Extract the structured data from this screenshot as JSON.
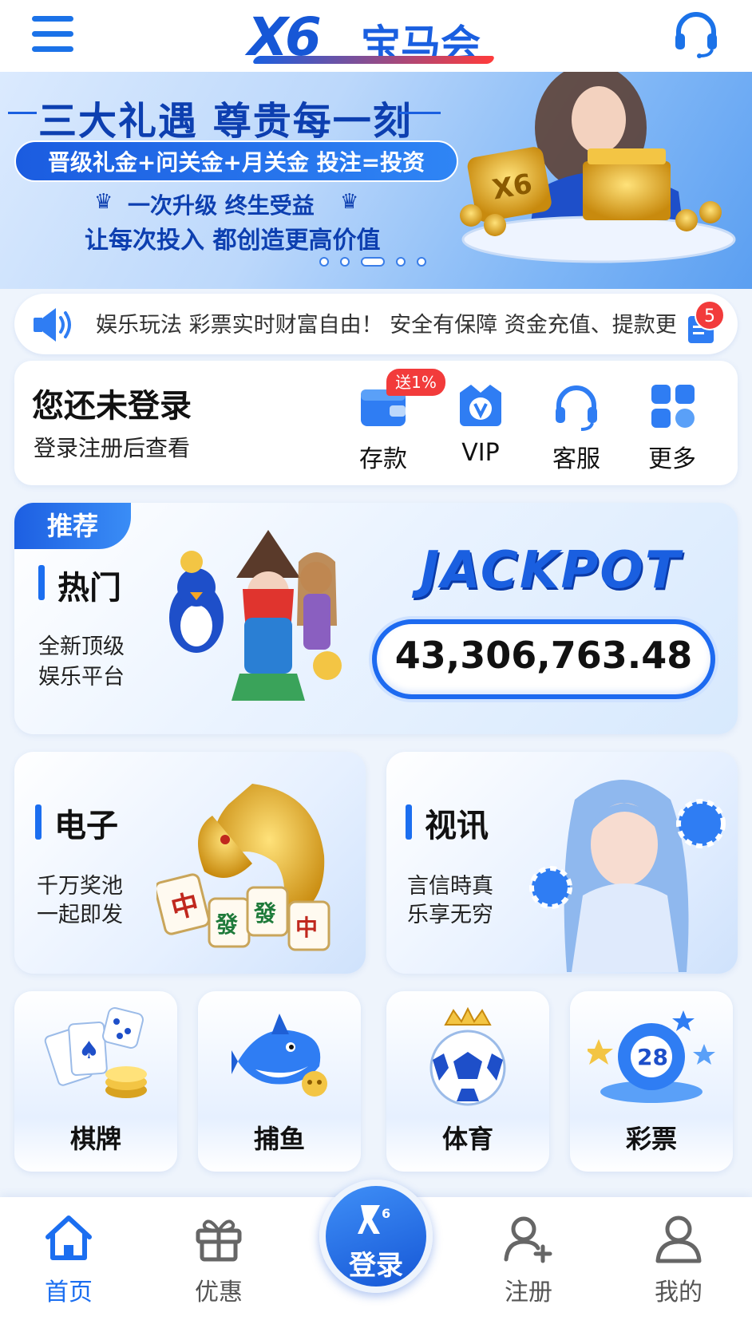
{
  "header": {
    "logo_mark": "X6",
    "logo_brand": "宝马会"
  },
  "banner": {
    "title": "三大礼遇 尊贵每一刻",
    "pill_text": "晋级礼金+问关金+月关金 投注=投资",
    "line3": "一次升级 终生受益",
    "line4": "让每次投入 都创造更高价值",
    "pages": 5,
    "active_page": 3
  },
  "notice": {
    "text": "娱乐玩法 彩票实时财富自由！ 安全有保障 资金充值、提款更",
    "unread_count": "5"
  },
  "login": {
    "title": "您还未登录",
    "subtitle": "登录注册后查看",
    "promo_badge": "送1%",
    "actions": [
      {
        "label": "存款",
        "icon": "wallet-icon"
      },
      {
        "label": "VIP",
        "icon": "vip-shield-icon"
      },
      {
        "label": "客服",
        "icon": "headset-icon"
      },
      {
        "label": "更多",
        "icon": "grid-icon"
      }
    ]
  },
  "recommend": {
    "tag": "推荐",
    "title": "热门",
    "desc_line1": "全新顶级",
    "desc_line2": "娱乐平台",
    "jackpot_label": "JACKPOT",
    "jackpot_value": "43,306,763.48"
  },
  "categories": {
    "electronic": {
      "title": "电子",
      "desc_line1": "千万奖池",
      "desc_line2": "一起即发"
    },
    "live": {
      "title": "视讯",
      "desc_line1": "言信時真",
      "desc_line2": "乐享无穷"
    },
    "small": [
      {
        "label": "棋牌",
        "icon": "cards-chips-icon"
      },
      {
        "label": "捕鱼",
        "icon": "shark-icon"
      },
      {
        "label": "体育",
        "icon": "soccer-ball-icon"
      },
      {
        "label": "彩票",
        "icon": "lottery-ball-icon"
      }
    ]
  },
  "bottom_nav": {
    "items": [
      {
        "label": "首页",
        "icon": "home-icon",
        "active": true
      },
      {
        "label": "优惠",
        "icon": "gift-icon",
        "active": false
      },
      {
        "label": "注册",
        "icon": "add-user-icon",
        "active": false
      },
      {
        "label": "我的",
        "icon": "user-icon",
        "active": false
      }
    ],
    "center_label": "登录"
  },
  "colors": {
    "primary": "#1b6ef0",
    "badge_red": "#f23b3b",
    "background": "#eef4fc"
  }
}
